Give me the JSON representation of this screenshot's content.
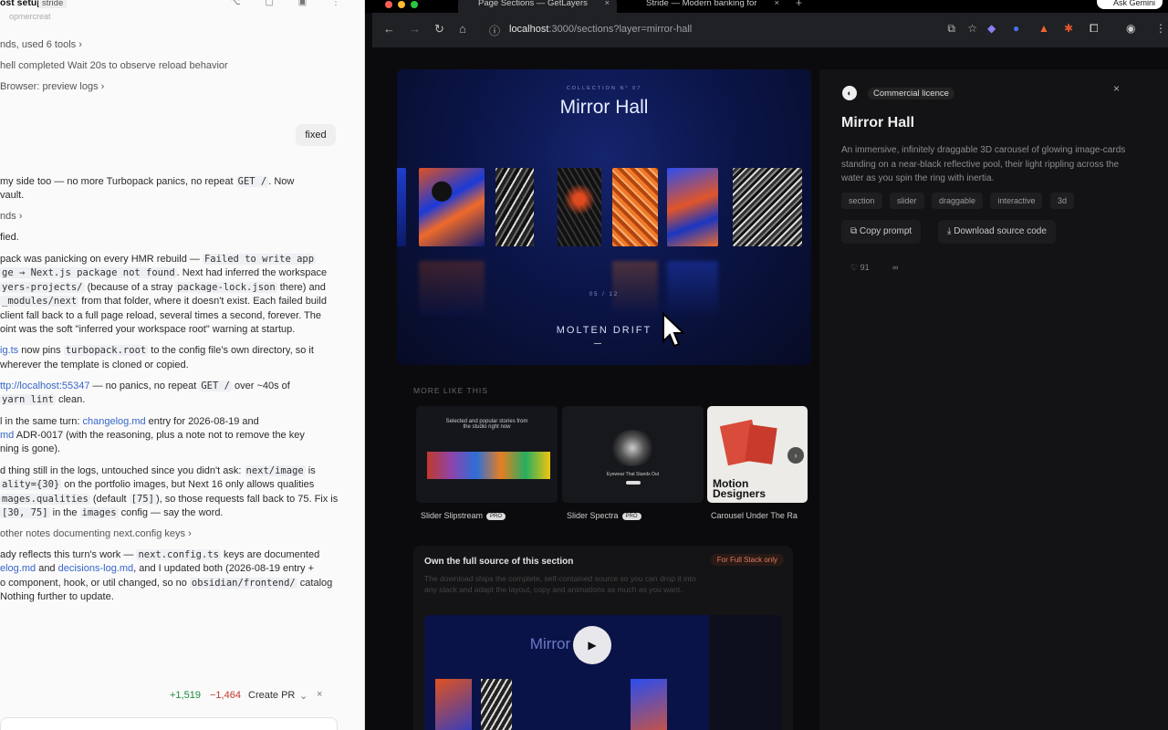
{
  "left": {
    "window_title": "ost setup",
    "window_tag": "stride",
    "window_sub": "opmercreat",
    "lines": [
      {
        "type": "step",
        "text": "nds, used 6 tools ›"
      },
      {
        "type": "step",
        "text": "hell completed Wait 20s to observe reload behavior"
      },
      {
        "type": "step",
        "text": "Browser: preview logs ›"
      }
    ],
    "user_message": "fixed",
    "reply_a1": "my side too — no more Turbopack panics, no repeat ",
    "reply_a1_code": "GET /",
    "reply_a1_end": ". Now",
    "reply_a2": "vault.",
    "step_b": "nds ›",
    "reply_b": "fied.",
    "para1": [
      {
        "t": "pack was panicking on every HMR rebuild — ",
        "c": "Failed to write app"
      },
      {
        "t": "",
        "c": "ge → Next.js package not found",
        "t2": ". Next had inferred the workspace"
      },
      {
        "t": "",
        "c": "yers-projects/",
        "t2": " (because of a stray ",
        "c2": "package-lock.json",
        "t3": " there) and"
      },
      {
        "t": "",
        "c": "_modules/next",
        "t2": " from that folder, where it doesn't exist. Each failed build"
      },
      {
        "t": "client fall back to a full page reload, several times a second, forever. The"
      },
      {
        "t": "oint was the soft \"inferred your workspace root\" warning at startup."
      }
    ],
    "para2_link": "ig.ts",
    "para2_a": " now pins ",
    "para2_code": "turbopack.root",
    "para2_b": " to the config file's own directory, so it",
    "para2_line2": "wherever the template is cloned or copied.",
    "para3_link": "ttp://localhost:55347",
    "para3_a": " — no panics, no repeat ",
    "para3_code": "GET /",
    "para3_b": " over ~40s of",
    "para3_code2": "yarn lint",
    "para3_c": " clean.",
    "para4_a": "l in the same turn: ",
    "para4_link": "changelog.md",
    "para4_b": " entry for 2026-08-19 and",
    "para4_line2a": "md",
    "para4_line2b": " ADR-0017 (with the reasoning, plus a note not to remove the key",
    "para4_line3": "ning is gone).",
    "para5_a": "d thing still in the logs, untouched since you didn't ask: ",
    "para5_code": "next/image",
    "para5_b": " is",
    "para5_code2": "ality={30}",
    "para5_c": " on the portfolio images, but Next 16 only allows qualities",
    "para5_code3": "mages.qualities",
    "para5_d": " (default ",
    "para5_code4": "[75]",
    "para5_e": "), so those requests fall back to 75. Fix is",
    "para5_code5": "[30, 75]",
    "para5_f": " in the ",
    "para5_code6": "images",
    "para5_g": " config — say the word.",
    "step_c": "other notes documenting next.config keys ›",
    "para6_a": "ady reflects this turn's work — ",
    "para6_code": "next.config.ts",
    "para6_b": " keys are documented",
    "para6_line2_link": "elog.md",
    "para6_line2_a": " and ",
    "para6_line2_link2": "decisions-log.md",
    "para6_line2_b": ", and I updated both (2026-08-19 entry +",
    "para6_line3_a": "o component, hook, or util changed, so no ",
    "para6_line3_code": "obsidian/frontend/",
    "para6_line3_b": " catalog",
    "para6_line4": "Nothing further to update.",
    "diff_added": "+1,519",
    "diff_removed": "−1,464",
    "create_pr": "Create PR",
    "chevron": "⌄",
    "close": "×"
  },
  "browser": {
    "tabs": [
      {
        "label": "Page Sections — GetLayers",
        "close": "×"
      },
      {
        "label": "Stride — Modern banking for",
        "close": "×"
      }
    ],
    "new_tab": "+",
    "ask_gemini": "Ask Gemini",
    "url_host": "localhost",
    "url_path": ":3000/sections?layer=mirror-hall",
    "nav_back": "←",
    "nav_forward": "→",
    "nav_reload": "↻",
    "nav_home": "⌂"
  },
  "preview": {
    "kicker": "COLLECTION N° 07",
    "title": "Mirror Hall",
    "card_labels": [
      "",
      "",
      "",
      "",
      "",
      ""
    ],
    "index": "05 / 12",
    "caption": "MOLTEN DRIFT"
  },
  "detail": {
    "licence": "Commercial licence",
    "title": "Mirror Hall",
    "description": "An immersive, infinitely draggable 3D carousel of glowing image-cards standing on a near-black reflective pool, their light rippling across the water as you spin the ring with inertia.",
    "tags": [
      "section",
      "slider",
      "draggable",
      "interactive",
      "3d"
    ],
    "copy_prompt": "Copy prompt",
    "download_source": "Download source code",
    "likes": "91",
    "close": "×"
  },
  "more": {
    "heading": "MORE LIKE THIS",
    "items": [
      {
        "name": "Slider Slipstream",
        "badge": "PRO",
        "headline": "Selected and popular stories from the studio right now"
      },
      {
        "name": "Slider Spectra",
        "badge": "PRO",
        "headline": "Eyewear That Stands Out"
      },
      {
        "name": "Carousel Under The Ra",
        "headline": "Motion Designers"
      }
    ]
  },
  "own": {
    "heading": "Own the full source of this section",
    "pill": "For Full Stack only",
    "body": "The download ships the complete, self-contained source so you can drop it into any stack and adapt the layout, copy and animations as much as you want.",
    "preview_title": "Mirror Hall"
  },
  "colors": {
    "accent_blue": "#3766c8",
    "diff_green": "#1a8a3a",
    "diff_red": "#c0392b",
    "pill_orange": "#e07a5f"
  }
}
